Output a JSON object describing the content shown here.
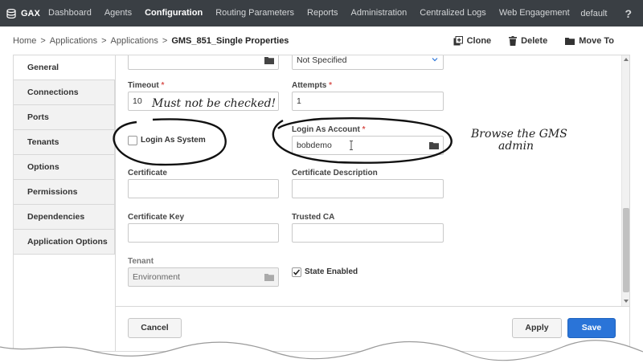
{
  "topnav": {
    "brand": "GAX",
    "items": [
      "Dashboard",
      "Agents",
      "Configuration",
      "Routing Parameters",
      "Reports",
      "Administration",
      "Centralized Logs",
      "Web Engagement"
    ],
    "user": "default",
    "help": "?"
  },
  "breadcrumb": [
    "Home",
    "Applications",
    "Applications",
    "GMS_851_Single Properties"
  ],
  "breadcrumb_sep": ">",
  "actions": {
    "clone": "Clone",
    "delete": "Delete",
    "move": "Move To"
  },
  "sidebar": [
    "General",
    "Connections",
    "Ports",
    "Tenants",
    "Options",
    "Permissions",
    "Dependencies",
    "Application Options"
  ],
  "form": {
    "top_select_value": "Not Specified",
    "timeout": {
      "label": "Timeout",
      "value": "10"
    },
    "attempts": {
      "label": "Attempts",
      "value": "1"
    },
    "login_as_system": {
      "label": "Login As System",
      "checked": false
    },
    "login_as_account": {
      "label": "Login As Account",
      "value": "bobdemo"
    },
    "certificate": {
      "label": "Certificate",
      "value": ""
    },
    "certificate_description": {
      "label": "Certificate Description",
      "value": ""
    },
    "certificate_key": {
      "label": "Certificate Key",
      "value": ""
    },
    "trusted_ca": {
      "label": "Trusted CA",
      "value": ""
    },
    "tenant": {
      "label": "Tenant",
      "value": "Environment"
    },
    "state_enabled": {
      "label": "State Enabled",
      "checked": true
    },
    "required_mark": "*"
  },
  "buttons": {
    "cancel": "Cancel",
    "apply": "Apply",
    "save": "Save"
  },
  "annotations": {
    "must_not": "Must not be checked!",
    "browse_line1": "Browse the GMS",
    "browse_line2": "admin"
  },
  "colors": {
    "nav_bg": "#3a3f44",
    "primary": "#2a74d8",
    "required": "#d9534f"
  }
}
